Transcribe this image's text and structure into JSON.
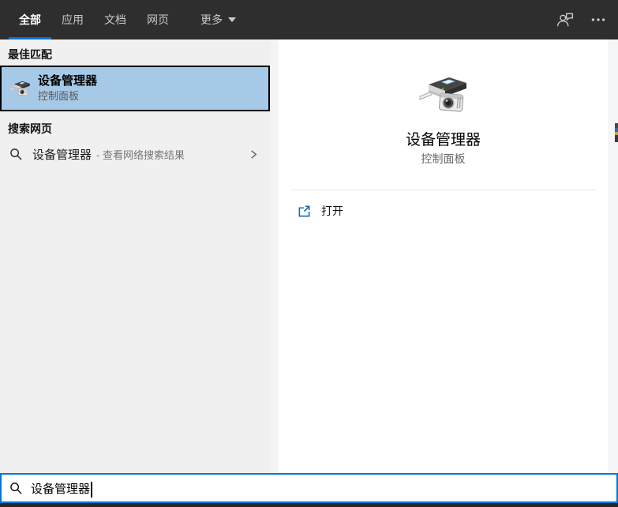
{
  "header": {
    "tabs": [
      {
        "label": "全部",
        "active": true
      },
      {
        "label": "应用",
        "active": false
      },
      {
        "label": "文档",
        "active": false
      },
      {
        "label": "网页",
        "active": false
      }
    ],
    "more": {
      "label": "更多"
    },
    "icons": {
      "feedback": "person-with-speech-bubble",
      "options": "ellipsis"
    }
  },
  "left_panel": {
    "best_match_header": "最佳匹配",
    "best_match": {
      "title": "设备管理器",
      "subtitle": "控制面板",
      "icon": "device-manager-icon"
    },
    "web_section_header": "搜索网页",
    "web_suggestion": {
      "query": "设备管理器",
      "hint": "- 查看网络搜索结果",
      "icon": "search-icon",
      "chevron": "chevron-right-icon"
    }
  },
  "preview_panel": {
    "title": "设备管理器",
    "subtitle": "控制面板",
    "icon": "device-manager-icon",
    "open_action": {
      "label": "打开",
      "icon": "open-external-icon"
    }
  },
  "search_bar": {
    "value": "设备管理器",
    "icon": "search-icon"
  },
  "colors": {
    "accent_blue": "#0078d7",
    "header_bg": "#2e2e2e",
    "best_match_highlight": "#a6c9e8",
    "open_icon_blue": "#0f6cbd",
    "left_panel_bg": "#f0f0f1"
  }
}
